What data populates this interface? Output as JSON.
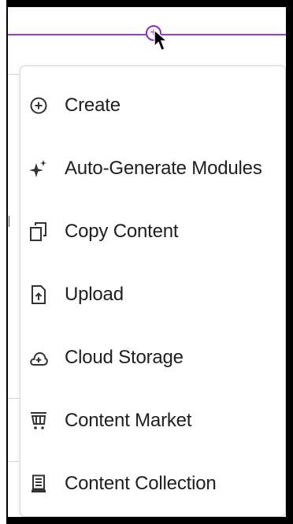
{
  "menu": {
    "items": [
      {
        "label": "Create",
        "icon": "plus-circle-icon"
      },
      {
        "label": "Auto-Generate Modules",
        "icon": "sparkle-icon"
      },
      {
        "label": "Copy Content",
        "icon": "copy-icon"
      },
      {
        "label": "Upload",
        "icon": "upload-file-icon"
      },
      {
        "label": "Cloud Storage",
        "icon": "cloud-plus-icon"
      },
      {
        "label": "Content Market",
        "icon": "cart-icon"
      },
      {
        "label": "Content Collection",
        "icon": "collection-icon"
      }
    ]
  },
  "colors": {
    "accent": "#8e2fc4",
    "text": "#202020",
    "frame": "#000000"
  }
}
